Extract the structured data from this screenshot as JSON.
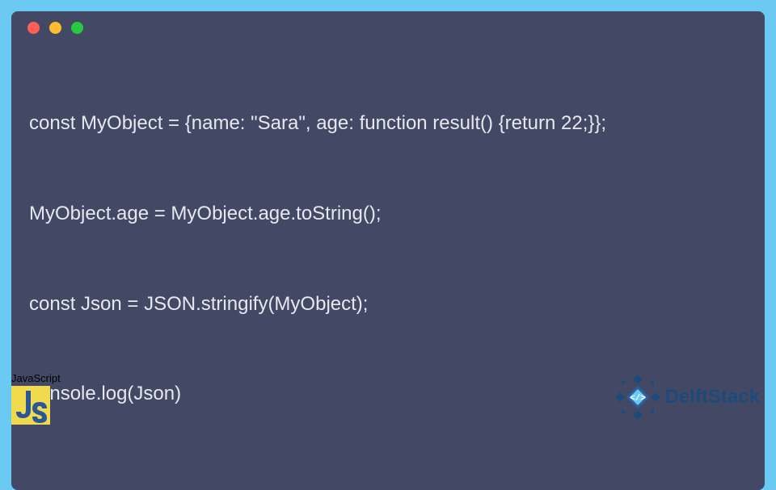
{
  "code": {
    "lines": [
      "const MyObject = {name: \"Sara\", age: function result() {return 22;}};",
      "MyObject.age = MyObject.age.toString();",
      "const Json = JSON.stringify(MyObject);",
      "console.log(Json)"
    ]
  },
  "js_badge": {
    "label": "JavaScript",
    "logo_text": "JS"
  },
  "delft": {
    "brand": "DelftStack"
  },
  "window": {
    "dots": [
      "red",
      "yellow",
      "green"
    ]
  }
}
